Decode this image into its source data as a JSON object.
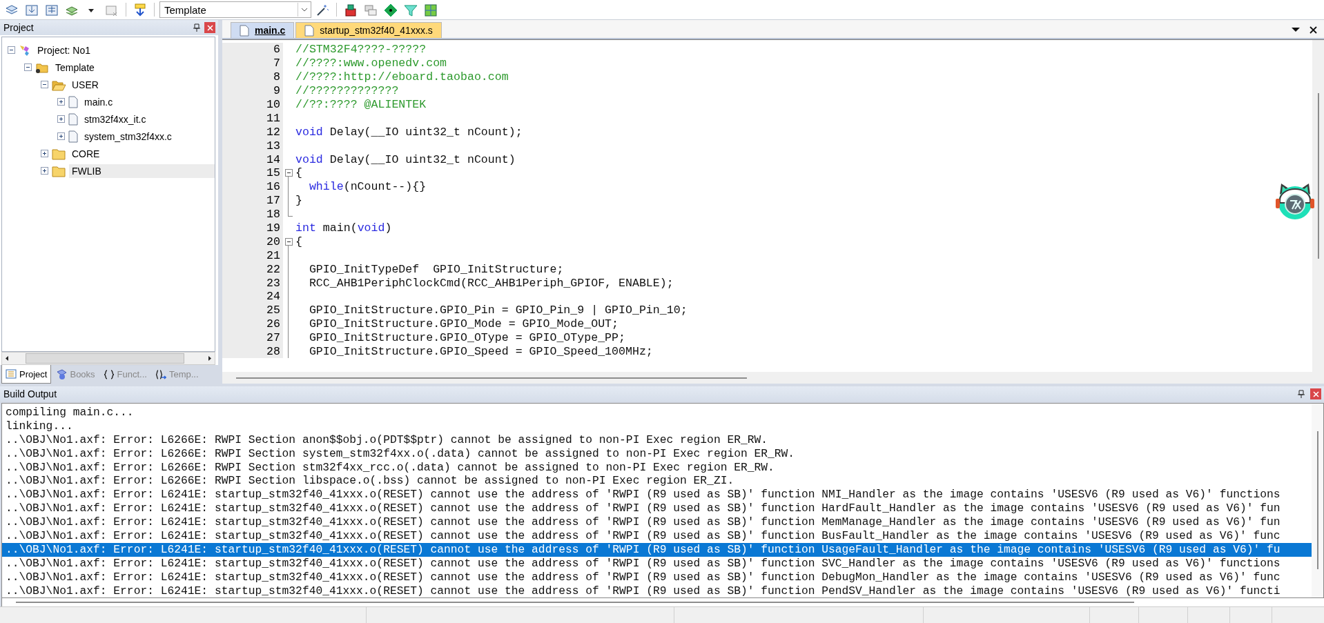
{
  "toolbar": {
    "target_select": {
      "value": "Template"
    }
  },
  "project_panel": {
    "title": "Project",
    "tree": [
      {
        "label": "Project: No1",
        "kind": "project",
        "expanded": true,
        "selected": false,
        "children": [
          {
            "label": "Template",
            "kind": "target",
            "expanded": true,
            "selected": false,
            "children": [
              {
                "label": "USER",
                "kind": "folder",
                "expanded": true,
                "selected": false,
                "children": [
                  {
                    "label": "main.c",
                    "kind": "file",
                    "expanded": false,
                    "selected": false
                  },
                  {
                    "label": "stm32f4xx_it.c",
                    "kind": "file",
                    "expanded": false,
                    "selected": false
                  },
                  {
                    "label": "system_stm32f4xx.c",
                    "kind": "file",
                    "expanded": false,
                    "selected": false
                  }
                ]
              },
              {
                "label": "CORE",
                "kind": "folder",
                "expanded": false,
                "selected": false
              },
              {
                "label": "FWLIB",
                "kind": "folder",
                "expanded": false,
                "selected": true
              }
            ]
          }
        ]
      }
    ],
    "tabs": [
      {
        "label": "Project",
        "kind": "project",
        "selected": true
      },
      {
        "label": "Books",
        "kind": "books",
        "selected": false
      },
      {
        "label": "Funct...",
        "kind": "functions",
        "selected": false
      },
      {
        "label": "Temp...",
        "kind": "templates",
        "selected": false
      }
    ]
  },
  "editor": {
    "tabs": [
      {
        "label": "main.c",
        "selected": true
      },
      {
        "label": "startup_stm32f40_41xxx.s",
        "selected": false
      }
    ],
    "lines": [
      {
        "number": "6",
        "tokens": [
          {
            "kind": "comment",
            "text": "//STM32F4????-?????"
          }
        ]
      },
      {
        "number": "7",
        "tokens": [
          {
            "kind": "comment",
            "text": "//????:www.openedv.com"
          }
        ]
      },
      {
        "number": "8",
        "tokens": [
          {
            "kind": "comment",
            "text": "//????:http://eboard.taobao.com"
          }
        ]
      },
      {
        "number": "9",
        "tokens": [
          {
            "kind": "comment",
            "text": "//?????????????"
          }
        ]
      },
      {
        "number": "10",
        "tokens": [
          {
            "kind": "comment",
            "text": "//??:???? @ALIENTEK"
          }
        ]
      },
      {
        "number": "11"
      },
      {
        "number": "12",
        "tokens": [
          {
            "kind": "keyword",
            "text": "void"
          },
          {
            "kind": "plain",
            "text": " Delay(__IO uint32_t nCount);"
          }
        ]
      },
      {
        "number": "13"
      },
      {
        "number": "14",
        "tokens": [
          {
            "kind": "keyword",
            "text": "void"
          },
          {
            "kind": "plain",
            "text": " Delay(__IO uint32_t nCount)"
          }
        ]
      },
      {
        "number": "15",
        "kind": "fold_start",
        "expanded": true,
        "tokens": [
          {
            "kind": "plain",
            "text": "{"
          }
        ]
      },
      {
        "number": "16",
        "kind": "fold_body",
        "indented": true,
        "tokens": [
          {
            "kind": "keyword",
            "text": "while"
          },
          {
            "kind": "plain",
            "text": "(nCount--){}"
          }
        ]
      },
      {
        "number": "17",
        "kind": "fold_body",
        "tokens": [
          {
            "kind": "plain",
            "text": "}"
          }
        ]
      },
      {
        "number": "18",
        "kind": "fold_end"
      },
      {
        "number": "19",
        "tokens": [
          {
            "kind": "keyword",
            "text": "int"
          },
          {
            "kind": "plain",
            "text": " main("
          },
          {
            "kind": "keyword",
            "text": "void"
          },
          {
            "kind": "plain",
            "text": ")"
          }
        ]
      },
      {
        "number": "20",
        "kind": "fold_start",
        "expanded": true,
        "tokens": [
          {
            "kind": "plain",
            "text": "{"
          }
        ]
      },
      {
        "number": "21",
        "kind": "fold_body"
      },
      {
        "number": "22",
        "kind": "fold_body",
        "indented": true,
        "tokens": [
          {
            "kind": "plain",
            "text": "GPIO_InitTypeDef  GPIO_InitStructure;"
          }
        ]
      },
      {
        "number": "23",
        "kind": "fold_body",
        "indented": true,
        "tokens": [
          {
            "kind": "plain",
            "text": "RCC_AHB1PeriphClockCmd(RCC_AHB1Periph_GPIOF, ENABLE);"
          }
        ]
      },
      {
        "number": "24",
        "kind": "fold_body"
      },
      {
        "number": "25",
        "kind": "fold_body",
        "indented": true,
        "tokens": [
          {
            "kind": "plain",
            "text": "GPIO_InitStructure.GPIO_Pin = GPIO_Pin_9 | GPIO_Pin_10;"
          }
        ]
      },
      {
        "number": "26",
        "kind": "fold_body",
        "indented": true,
        "tokens": [
          {
            "kind": "plain",
            "text": "GPIO_InitStructure.GPIO_Mode = GPIO_Mode_OUT;"
          }
        ]
      },
      {
        "number": "27",
        "kind": "fold_body",
        "indented": true,
        "tokens": [
          {
            "kind": "plain",
            "text": "GPIO_InitStructure.GPIO_OType = GPIO_OType_PP;"
          }
        ]
      },
      {
        "number": "28",
        "kind": "fold_body",
        "indented": true,
        "tokens": [
          {
            "kind": "plain",
            "text": "GPIO_InitStructure.GPIO_Speed = GPIO_Speed_100MHz;"
          }
        ]
      }
    ]
  },
  "build_output": {
    "title": "Build Output",
    "lines": [
      {
        "text": "compiling main.c...",
        "selected": false
      },
      {
        "text": "linking...",
        "selected": false
      },
      {
        "text": "..\\OBJ\\No1.axf: Error: L6266E: RWPI Section anon$$obj.o(PDT$$ptr) cannot be assigned to non-PI Exec region ER_RW.",
        "selected": false
      },
      {
        "text": "..\\OBJ\\No1.axf: Error: L6266E: RWPI Section system_stm32f4xx.o(.data) cannot be assigned to non-PI Exec region ER_RW.",
        "selected": false
      },
      {
        "text": "..\\OBJ\\No1.axf: Error: L6266E: RWPI Section stm32f4xx_rcc.o(.data) cannot be assigned to non-PI Exec region ER_RW.",
        "selected": false
      },
      {
        "text": "..\\OBJ\\No1.axf: Error: L6266E: RWPI Section libspace.o(.bss) cannot be assigned to non-PI Exec region ER_ZI.",
        "selected": false
      },
      {
        "text": "..\\OBJ\\No1.axf: Error: L6241E: startup_stm32f40_41xxx.o(RESET) cannot use the address of 'RWPI (R9 used as SB)' function NMI_Handler as the image contains 'USESV6 (R9 used as V6)' functions",
        "selected": false
      },
      {
        "text": "..\\OBJ\\No1.axf: Error: L6241E: startup_stm32f40_41xxx.o(RESET) cannot use the address of 'RWPI (R9 used as SB)' function HardFault_Handler as the image contains 'USESV6 (R9 used as V6)' fun",
        "selected": false
      },
      {
        "text": "..\\OBJ\\No1.axf: Error: L6241E: startup_stm32f40_41xxx.o(RESET) cannot use the address of 'RWPI (R9 used as SB)' function MemManage_Handler as the image contains 'USESV6 (R9 used as V6)' fun",
        "selected": false
      },
      {
        "text": "..\\OBJ\\No1.axf: Error: L6241E: startup_stm32f40_41xxx.o(RESET) cannot use the address of 'RWPI (R9 used as SB)' function BusFault_Handler as the image contains 'USESV6 (R9 used as V6)' func",
        "selected": false
      },
      {
        "text": "..\\OBJ\\No1.axf: Error: L6241E: startup_stm32f40_41xxx.o(RESET) cannot use the address of 'RWPI (R9 used as SB)' function UsageFault_Handler as the image contains 'USESV6 (R9 used as V6)' fu",
        "selected": true
      },
      {
        "text": "..\\OBJ\\No1.axf: Error: L6241E: startup_stm32f40_41xxx.o(RESET) cannot use the address of 'RWPI (R9 used as SB)' function SVC_Handler as the image contains 'USESV6 (R9 used as V6)' functions",
        "selected": false
      },
      {
        "text": "..\\OBJ\\No1.axf: Error: L6241E: startup_stm32f40_41xxx.o(RESET) cannot use the address of 'RWPI (R9 used as SB)' function DebugMon_Handler as the image contains 'USESV6 (R9 used as V6)' func",
        "selected": false
      },
      {
        "text": "..\\OBJ\\No1.axf: Error: L6241E: startup_stm32f40_41xxx.o(RESET) cannot use the address of 'RWPI (R9 used as SB)' function PendSV_Handler as the image contains 'USESV6 (R9 used as V6)' functi",
        "selected": false
      }
    ]
  }
}
